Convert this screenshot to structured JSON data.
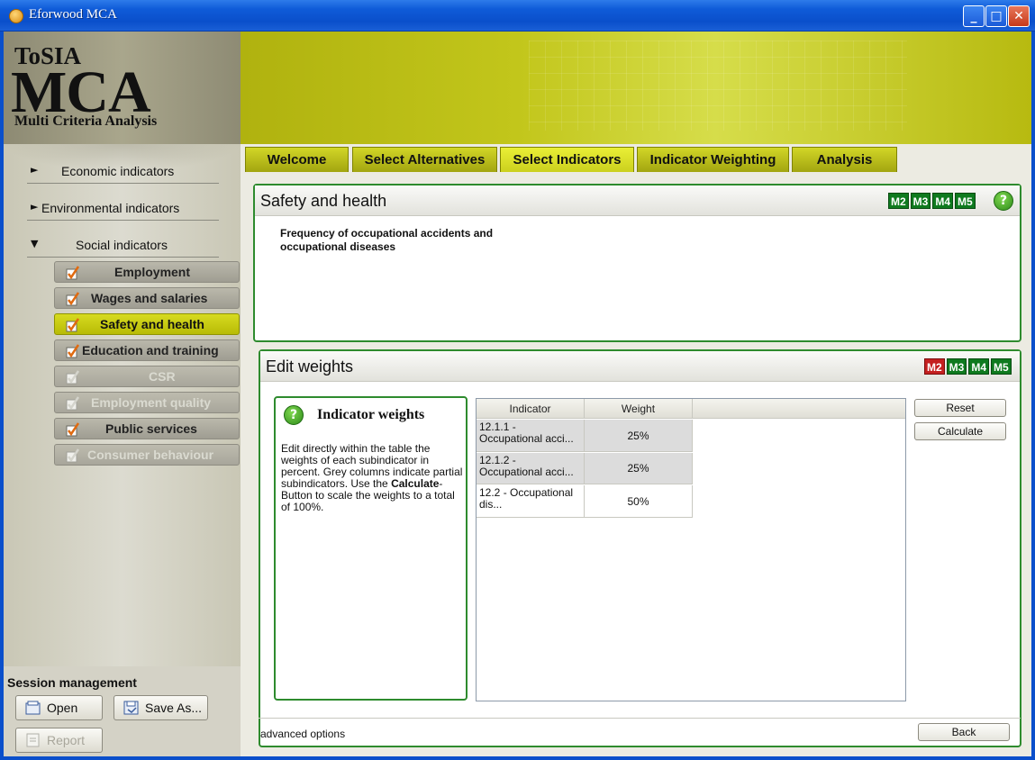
{
  "window": {
    "title": "Eforwood MCA",
    "min": "_",
    "max": "□",
    "close": "✕"
  },
  "logo": {
    "line1": "ToSIA",
    "line2": "MCA",
    "line3": "Multi Criteria Analysis"
  },
  "sidebar": {
    "groups": [
      {
        "arrow": "►",
        "label": "Economic indicators"
      },
      {
        "arrow": "►",
        "label": "Environmental indicators"
      },
      {
        "arrow": "▼",
        "label": "Social indicators"
      }
    ],
    "items": [
      {
        "label": "Employment"
      },
      {
        "label": "Wages and salaries"
      },
      {
        "label": "Safety and health"
      },
      {
        "label": "Education and training"
      },
      {
        "label": "CSR"
      },
      {
        "label": "Employment quality"
      },
      {
        "label": "Public services"
      },
      {
        "label": "Consumer behaviour"
      }
    ]
  },
  "session": {
    "title": "Session management",
    "open": "Open",
    "save_as": "Save As...",
    "report": "Report"
  },
  "tabs": [
    "Welcome",
    "Select Alternatives",
    "Select Indicators",
    "Indicator Weighting",
    "Analysis"
  ],
  "indicator_panel": {
    "title": "Safety and health",
    "badges": [
      "M2",
      "M3",
      "M4",
      "M5"
    ],
    "help": "?",
    "description": "Frequency of occupational accidents and occupational diseases"
  },
  "weights_panel": {
    "title": "Edit weights",
    "badges": [
      "M2",
      "M3",
      "M4",
      "M5"
    ],
    "box_title": "Indicator weights",
    "help": "?",
    "text_part1": "Edit directly within the table the weights of each subindicator in percent. Grey columns indicate partial subindicators. Use the ",
    "text_bold": "Calculate",
    "text_part2": "-Button to scale the weights to a total of 100%.",
    "table": {
      "headers": [
        "Indicator",
        "Weight"
      ],
      "rows": [
        {
          "indicator": "12.1.1 - Occupational acci...",
          "weight": "25%"
        },
        {
          "indicator": "12.1.2 - Occupational acci...",
          "weight": "25%"
        },
        {
          "indicator": "12.2 - Occupational dis...",
          "weight": "50%"
        }
      ]
    },
    "reset": "Reset",
    "calculate": "Calculate",
    "advanced": "advanced options",
    "back": "Back"
  },
  "colors": {
    "accent": "#c6ca1b",
    "border_green": "#2e8b2e",
    "badge_green": "#0f7a1f",
    "badge_red": "#c42020"
  }
}
